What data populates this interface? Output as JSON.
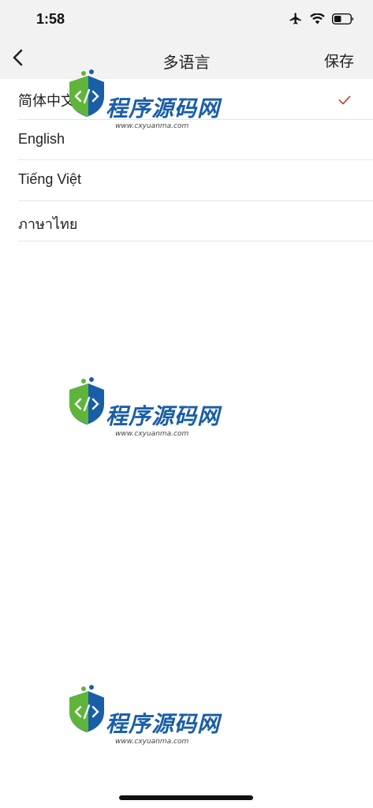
{
  "status_bar": {
    "time": "1:58",
    "icons": [
      "airplane-icon",
      "wifi-icon",
      "battery-icon"
    ]
  },
  "nav": {
    "back_icon": "chevron-left-icon",
    "title": "多语言",
    "save_label": "保存"
  },
  "languages": [
    {
      "label": "简体中文",
      "selected": true
    },
    {
      "label": "English",
      "selected": false
    },
    {
      "label": "Tiếng Việt",
      "selected": false
    },
    {
      "label": "ภาษาไทย",
      "selected": false
    }
  ],
  "watermark": {
    "text": "程序源码网",
    "url": "www.cxyuanma.com"
  },
  "colors": {
    "bar_background": "#f2f2f2",
    "check": "#b5533c",
    "divider": "#e6e6e6",
    "watermark_blue": "#1a5ea8",
    "watermark_green": "#5fb53a"
  }
}
